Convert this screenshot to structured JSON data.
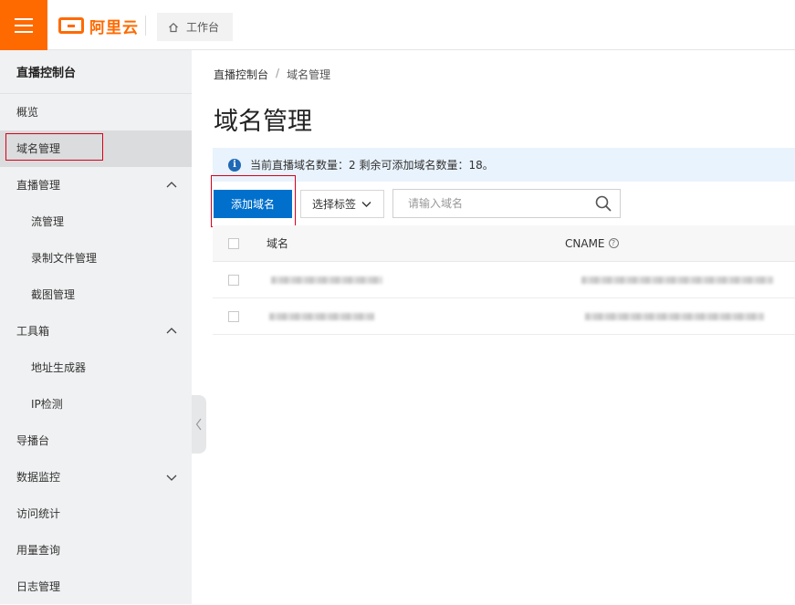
{
  "topbar": {
    "brand": "阿里云",
    "workbench_label": "工作台"
  },
  "sidebar": {
    "title": "直播控制台",
    "items": [
      {
        "label": "概览"
      },
      {
        "label": "域名管理"
      },
      {
        "label": "直播管理"
      },
      {
        "label": "流管理"
      },
      {
        "label": "录制文件管理"
      },
      {
        "label": "截图管理"
      },
      {
        "label": "工具箱"
      },
      {
        "label": "地址生成器"
      },
      {
        "label": "IP检测"
      },
      {
        "label": "导播台"
      },
      {
        "label": "数据监控"
      },
      {
        "label": "访问统计"
      },
      {
        "label": "用量查询"
      },
      {
        "label": "日志管理"
      }
    ]
  },
  "main": {
    "breadcrumb": [
      "直播控制台",
      "/",
      "域名管理"
    ],
    "title": "域名管理",
    "notice": "当前直播域名数量：2 剩余可添加域名数量：18。",
    "add_button": "添加域名",
    "tag_select": "选择标签",
    "search_placeholder": "请输入域名",
    "table": {
      "columns": [
        "域名",
        "CNAME"
      ]
    }
  },
  "colors": {
    "brand_orange": "#ff6a00",
    "primary_blue": "#0070cc",
    "highlight_red": "#d9001b"
  }
}
